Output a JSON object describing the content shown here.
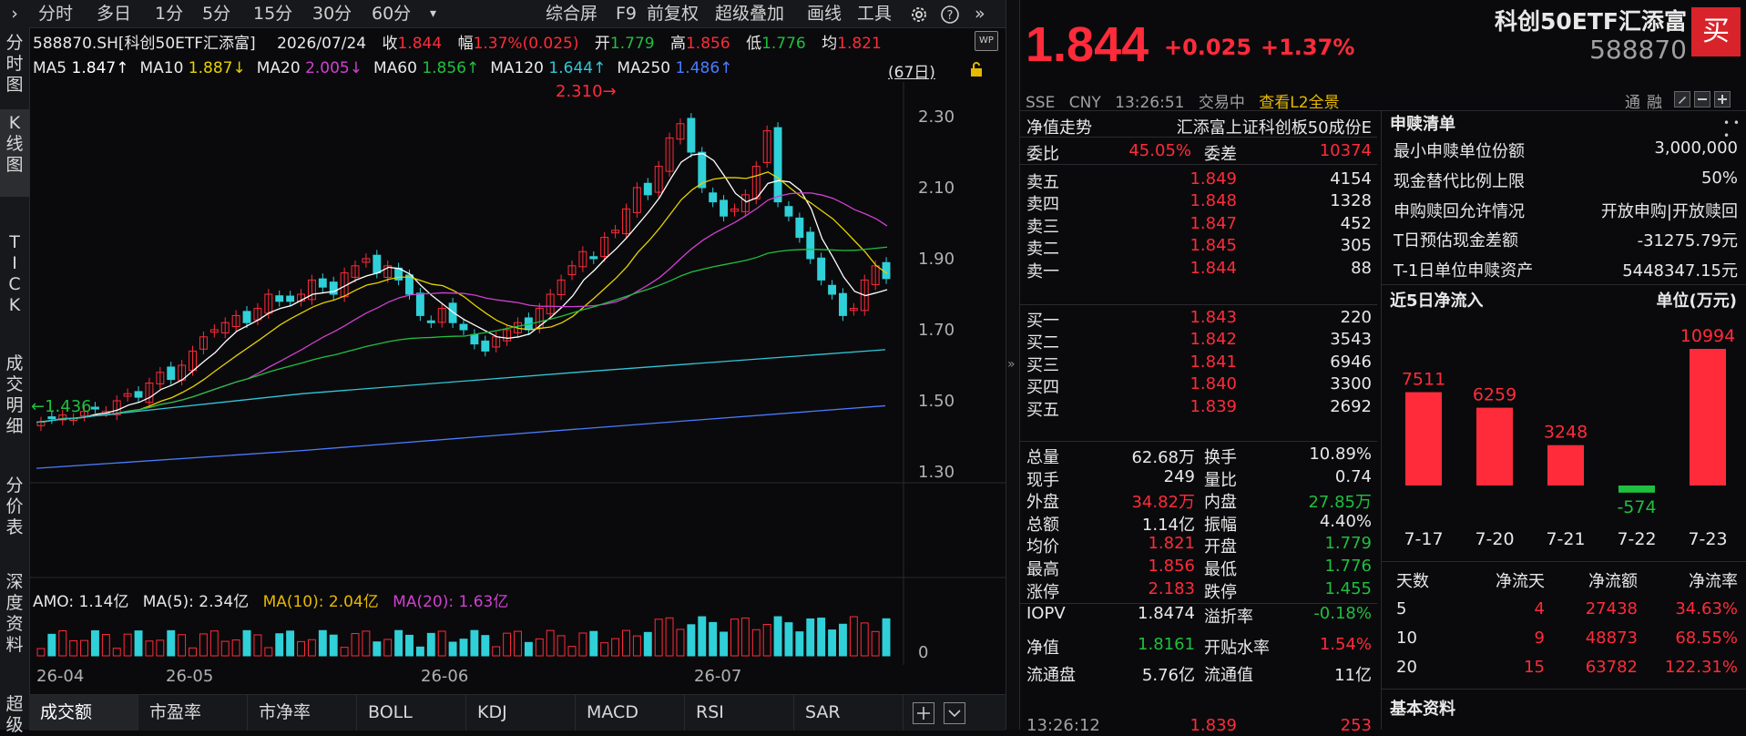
{
  "left_tabs": [
    "分时图",
    "K线图",
    "TICK",
    "成交明细",
    "分价表",
    "深度资料",
    "超级"
  ],
  "period_tabs": [
    "分时",
    "多日",
    "1分",
    "5分",
    "15分",
    "30分",
    "60分"
  ],
  "period_more": "▾",
  "toolbar": {
    "items": [
      "综合屏",
      "F9",
      "前复权",
      "超级叠加",
      "画线",
      "工具"
    ]
  },
  "info": {
    "code": "588870.SH[科创50ETF汇添富]",
    "date": "2026/07/24",
    "close_label": "收",
    "close": "1.844",
    "range_label": "幅",
    "range": "1.37%(0.025)",
    "open_label": "开",
    "open": "1.779",
    "high_label": "高",
    "high": "1.856",
    "low_label": "低",
    "low": "1.776",
    "avg_label": "均",
    "avg": "1.821"
  },
  "ma": [
    {
      "label": "MA5",
      "value": "1.847↑",
      "color": "#ffffff"
    },
    {
      "label": "MA10",
      "value": "1.887↓",
      "color": "#e6d200"
    },
    {
      "label": "MA20",
      "value": "2.005↓",
      "color": "#d040d0"
    },
    {
      "label": "MA60",
      "value": "1.856↑",
      "color": "#20c040"
    },
    {
      "label": "MA120",
      "value": "1.644↑",
      "color": "#30c8d8"
    },
    {
      "label": "MA250",
      "value": "1.486↑",
      "color": "#4a7cff"
    }
  ],
  "ma_colors": {
    "MA5": "#ffffff",
    "MA10": "#e6d200",
    "MA20": "#d040d0",
    "MA60": "#20c040",
    "MA120": "#30c8d8",
    "MA250": "#4a7cff"
  },
  "days_badge": "(67日)",
  "price_axis": [
    "2.30",
    "2.10",
    "1.90",
    "1.70",
    "1.50",
    "1.30"
  ],
  "max_label": "2.310",
  "min_label": "1.436",
  "x_labels": [
    "26-04",
    "26-05",
    "26-06",
    "26-07"
  ],
  "amo": {
    "label": "AMO: 1.14亿",
    "ma5": "MA(5): 2.34亿",
    "ma10": "MA(10): 2.04亿",
    "ma20": "MA(20): 1.63亿"
  },
  "vol_axis": "0",
  "indicator_tabs": [
    "成交额",
    "市盈率",
    "市净率",
    "BOLL",
    "KDJ",
    "MACD",
    "RSI",
    "SAR"
  ],
  "quote": {
    "price": "1.844",
    "change": "+0.025",
    "change_pct": "+1.37%",
    "name": "科创50ETF汇添富",
    "code": "588870",
    "buy_btn": "买",
    "exchange": "SSE",
    "currency": "CNY",
    "time": "13:26:51",
    "status": "交易中",
    "l2": "查看L2全景",
    "tong": "通",
    "rong": "融"
  },
  "nav_row": {
    "label": "净值走势",
    "value": "汇添富上证科创板50成份E"
  },
  "weibi": {
    "label": "委比",
    "value": "45.05%",
    "diff_label": "委差",
    "diff": "10374"
  },
  "asks": [
    {
      "label": "卖五",
      "price": "1.849",
      "vol": "4154"
    },
    {
      "label": "卖四",
      "price": "1.848",
      "vol": "1328"
    },
    {
      "label": "卖三",
      "price": "1.847",
      "vol": "452"
    },
    {
      "label": "卖二",
      "price": "1.845",
      "vol": "305"
    },
    {
      "label": "卖一",
      "price": "1.844",
      "vol": "88"
    }
  ],
  "bids": [
    {
      "label": "买一",
      "price": "1.843",
      "vol": "220"
    },
    {
      "label": "买二",
      "price": "1.842",
      "vol": "3543"
    },
    {
      "label": "买三",
      "price": "1.841",
      "vol": "6946"
    },
    {
      "label": "买四",
      "price": "1.840",
      "vol": "3300"
    },
    {
      "label": "买五",
      "price": "1.839",
      "vol": "2692"
    }
  ],
  "stats": [
    {
      "l1": "总量",
      "v1": "62.68万",
      "c1": "white",
      "l2": "换手",
      "v2": "10.89%",
      "c2": "white"
    },
    {
      "l1": "现手",
      "v1": "249",
      "c1": "white",
      "l2": "量比",
      "v2": "0.74",
      "c2": "white"
    },
    {
      "l1": "外盘",
      "v1": "34.82万",
      "c1": "red",
      "l2": "内盘",
      "v2": "27.85万",
      "c2": "green"
    },
    {
      "l1": "总额",
      "v1": "1.14亿",
      "c1": "white",
      "l2": "振幅",
      "v2": "4.40%",
      "c2": "white"
    },
    {
      "l1": "均价",
      "v1": "1.821",
      "c1": "red",
      "l2": "开盘",
      "v2": "1.779",
      "c2": "green"
    },
    {
      "l1": "最高",
      "v1": "1.856",
      "c1": "red",
      "l2": "最低",
      "v2": "1.776",
      "c2": "green"
    },
    {
      "l1": "涨停",
      "v1": "2.183",
      "c1": "red",
      "l2": "跌停",
      "v2": "1.455",
      "c2": "green"
    }
  ],
  "stats2": [
    {
      "l1": "IOPV",
      "v1": "1.8474",
      "c1": "white",
      "l2": "溢折率",
      "v2": "-0.18%",
      "c2": "green"
    },
    {
      "l1": "净值",
      "v1": "1.8161",
      "c1": "green",
      "l2": "开贴水率",
      "v2": "1.54%",
      "c2": "red"
    },
    {
      "l1": "流通盘",
      "v1": "5.76亿",
      "c1": "white",
      "l2": "流通值",
      "v2": "11亿",
      "c2": "white"
    }
  ],
  "last_trade": {
    "time": "13:26:12",
    "price": "1.839",
    "vol": "253"
  },
  "sg": {
    "title": "申赎清单",
    "rows": [
      {
        "label": "最小申赎单位份额",
        "value": "3,000,000"
      },
      {
        "label": "现金替代比例上限",
        "value": "50%"
      },
      {
        "label": "申购赎回允许情况",
        "value": "开放申购|开放赎回"
      },
      {
        "label": "T日预估现金差额",
        "value": "-31275.79元"
      },
      {
        "label": "T-1日单位申赎资产",
        "value": "5448347.15元"
      }
    ]
  },
  "flow_title": "近5日净流入",
  "flow_unit": "单位(万元)",
  "chart_data": {
    "type": "bar",
    "title": "近5日净流入",
    "categories": [
      "7-17",
      "7-20",
      "7-21",
      "7-22",
      "7-23"
    ],
    "values": [
      7511,
      6259,
      3248,
      -574,
      10994
    ],
    "ylabel": "单位(万元)",
    "colors": {
      "positive": "#ff2b3a",
      "negative": "#1fbf3f"
    }
  },
  "flow_table": {
    "headers": [
      "天数",
      "净流天",
      "净流额",
      "净流率"
    ],
    "rows": [
      [
        "5",
        "4",
        "27438",
        "34.63%"
      ],
      [
        "10",
        "9",
        "48873",
        "68.55%"
      ],
      [
        "20",
        "15",
        "63782",
        "122.31%"
      ]
    ]
  },
  "basic_title": "基本资料",
  "colors": {
    "up": "#ff2b3a",
    "down": "#1fbf3f",
    "candle_down": "#30d0d8",
    "bg": "#0a0a0c",
    "accent": "#e6b800"
  }
}
